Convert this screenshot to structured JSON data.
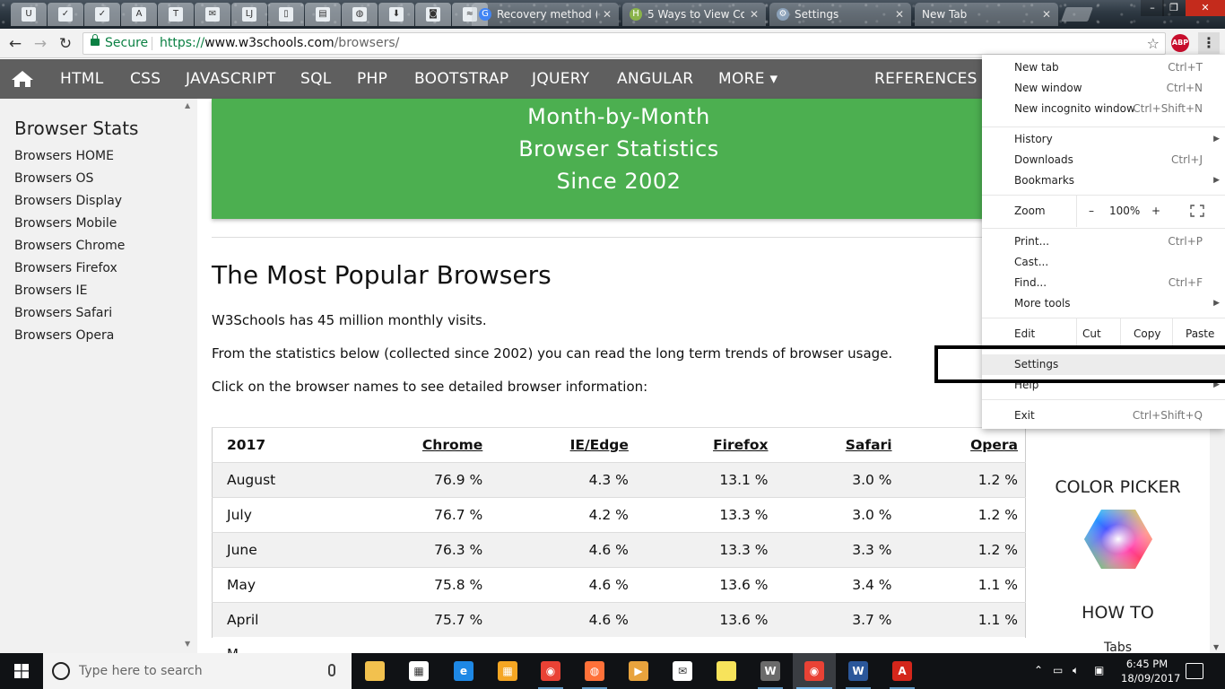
{
  "browser": {
    "pinned_tabs": [
      {
        "icon": "site-logo-icon",
        "glyph": "U"
      },
      {
        "icon": "checkmark-icon",
        "glyph": "✓"
      },
      {
        "icon": "checkmark-icon",
        "glyph": "✓"
      },
      {
        "icon": "anchor-icon",
        "glyph": "A"
      },
      {
        "icon": "nyt-icon",
        "glyph": "T"
      },
      {
        "icon": "mail-icon",
        "glyph": "✉"
      },
      {
        "icon": "lj-icon",
        "glyph": "LJ"
      },
      {
        "icon": "page-icon",
        "glyph": "▯"
      },
      {
        "icon": "bookmark-grid-icon",
        "glyph": "▤"
      },
      {
        "icon": "globe-icon",
        "glyph": "◍"
      },
      {
        "icon": "download-icon",
        "glyph": "⬇"
      },
      {
        "icon": "camera-icon",
        "glyph": "◙"
      },
      {
        "icon": "chart-icon",
        "glyph": "≈"
      }
    ],
    "tabs": [
      {
        "label": "Recovery method (",
        "icon": "google-icon",
        "color": "#4285f4",
        "glyph": "G"
      },
      {
        "label": "5 Ways to View Co",
        "icon": "wikihow-icon",
        "color": "#8ab34a",
        "glyph": "H"
      },
      {
        "label": "Settings",
        "icon": "gear-icon",
        "color": "#8aa0b8",
        "glyph": "⚙"
      },
      {
        "label": "New Tab",
        "icon": "",
        "color": "",
        "glyph": ""
      }
    ],
    "address": {
      "secure_label": "Secure",
      "url_scheme": "https://",
      "url_host": "www.w3schools.com",
      "url_path": "/browsers/"
    },
    "abp_label": "ABP"
  },
  "site": {
    "nav": [
      "HTML",
      "CSS",
      "JAVASCRIPT",
      "SQL",
      "PHP",
      "BOOTSTRAP",
      "JQUERY",
      "ANGULAR",
      "MORE ▾",
      "REFERENCES ▾"
    ],
    "sidebar": {
      "title": "Browser Stats",
      "links": [
        "Browsers HOME",
        "Browsers OS",
        "Browsers Display",
        "Browsers Mobile",
        "Browsers Chrome",
        "Browsers Firefox",
        "Browsers IE",
        "Browsers Safari",
        "Browsers Opera"
      ]
    },
    "banner": [
      "Month-by-Month",
      "Browser Statistics",
      "Since 2002"
    ],
    "title": "The Most Popular Browsers",
    "paragraphs": [
      "W3Schools has 45 million monthly visits.",
      "From the statistics below (collected since 2002) you can read the long term trends of browser usage.",
      "Click on the browser names to see detailed browser information:"
    ],
    "table": {
      "headers": [
        "2017",
        "Chrome",
        "IE/Edge",
        "Firefox",
        "Safari",
        "Opera"
      ],
      "rows": [
        [
          "August",
          "76.9 %",
          "4.3 %",
          "13.1 %",
          "3.0 %",
          "1.2 %"
        ],
        [
          "July",
          "76.7 %",
          "4.2 %",
          "13.3 %",
          "3.0 %",
          "1.2 %"
        ],
        [
          "June",
          "76.3 %",
          "4.6 %",
          "13.3 %",
          "3.3 %",
          "1.2 %"
        ],
        [
          "May",
          "75.8 %",
          "4.6 %",
          "13.6 %",
          "3.4 %",
          "1.1 %"
        ],
        [
          "April",
          "75.7 %",
          "4.6 %",
          "13.6 %",
          "3.7 %",
          "1.1 %"
        ]
      ]
    },
    "right_panel": {
      "color_picker": "COLOR PICKER",
      "how_to": "HOW TO",
      "tabs_link": "Tabs"
    }
  },
  "menu": {
    "group1": [
      {
        "label": "New tab",
        "shortcut": "Ctrl+T"
      },
      {
        "label": "New window",
        "shortcut": "Ctrl+N"
      },
      {
        "label": "New incognito window",
        "shortcut": "Ctrl+Shift+N"
      }
    ],
    "group2": [
      {
        "label": "History",
        "shortcut": "",
        "submenu": true
      },
      {
        "label": "Downloads",
        "shortcut": "Ctrl+J"
      },
      {
        "label": "Bookmarks",
        "shortcut": "",
        "submenu": true
      }
    ],
    "zoom": {
      "label": "Zoom",
      "minus": "–",
      "value": "100%",
      "plus": "+"
    },
    "group3": [
      {
        "label": "Print...",
        "shortcut": "Ctrl+P"
      },
      {
        "label": "Cast...",
        "shortcut": ""
      },
      {
        "label": "Find...",
        "shortcut": "Ctrl+F"
      },
      {
        "label": "More tools",
        "shortcut": "",
        "submenu": true
      }
    ],
    "edit": {
      "label": "Edit",
      "cut": "Cut",
      "copy": "Copy",
      "paste": "Paste"
    },
    "settings": "Settings",
    "help": "Help",
    "exit": {
      "label": "Exit",
      "shortcut": "Ctrl+Shift+Q"
    }
  },
  "taskbar": {
    "search_placeholder": "Type here to search",
    "apps": [
      {
        "icon": "file-explorer-icon",
        "color": "#f2c14e",
        "glyph": ""
      },
      {
        "icon": "store-icon",
        "color": "#ffffff",
        "glyph": "▦"
      },
      {
        "icon": "edge-icon",
        "color": "#1e88e5",
        "glyph": "e"
      },
      {
        "icon": "grid-app-icon",
        "color": "#f5a623",
        "glyph": "▦"
      },
      {
        "icon": "chrome-icon",
        "color": "#e94235",
        "glyph": "◉"
      },
      {
        "icon": "firefox-icon",
        "color": "#ff7139",
        "glyph": "◍"
      },
      {
        "icon": "media-player-icon",
        "color": "#e8a33d",
        "glyph": "▶"
      },
      {
        "icon": "mail-icon",
        "color": "#ffffff",
        "glyph": "✉"
      },
      {
        "icon": "sticky-notes-icon",
        "color": "#f7e35b",
        "glyph": ""
      },
      {
        "icon": "w-app-icon",
        "color": "#6b6b6b",
        "glyph": "W"
      },
      {
        "icon": "chrome-icon",
        "color": "#e94235",
        "glyph": "◉"
      },
      {
        "icon": "word-icon",
        "color": "#2b579a",
        "glyph": "W"
      },
      {
        "icon": "acrobat-icon",
        "color": "#d4261b",
        "glyph": "A"
      }
    ],
    "time": "6:45 PM",
    "date": "18/09/2017"
  }
}
